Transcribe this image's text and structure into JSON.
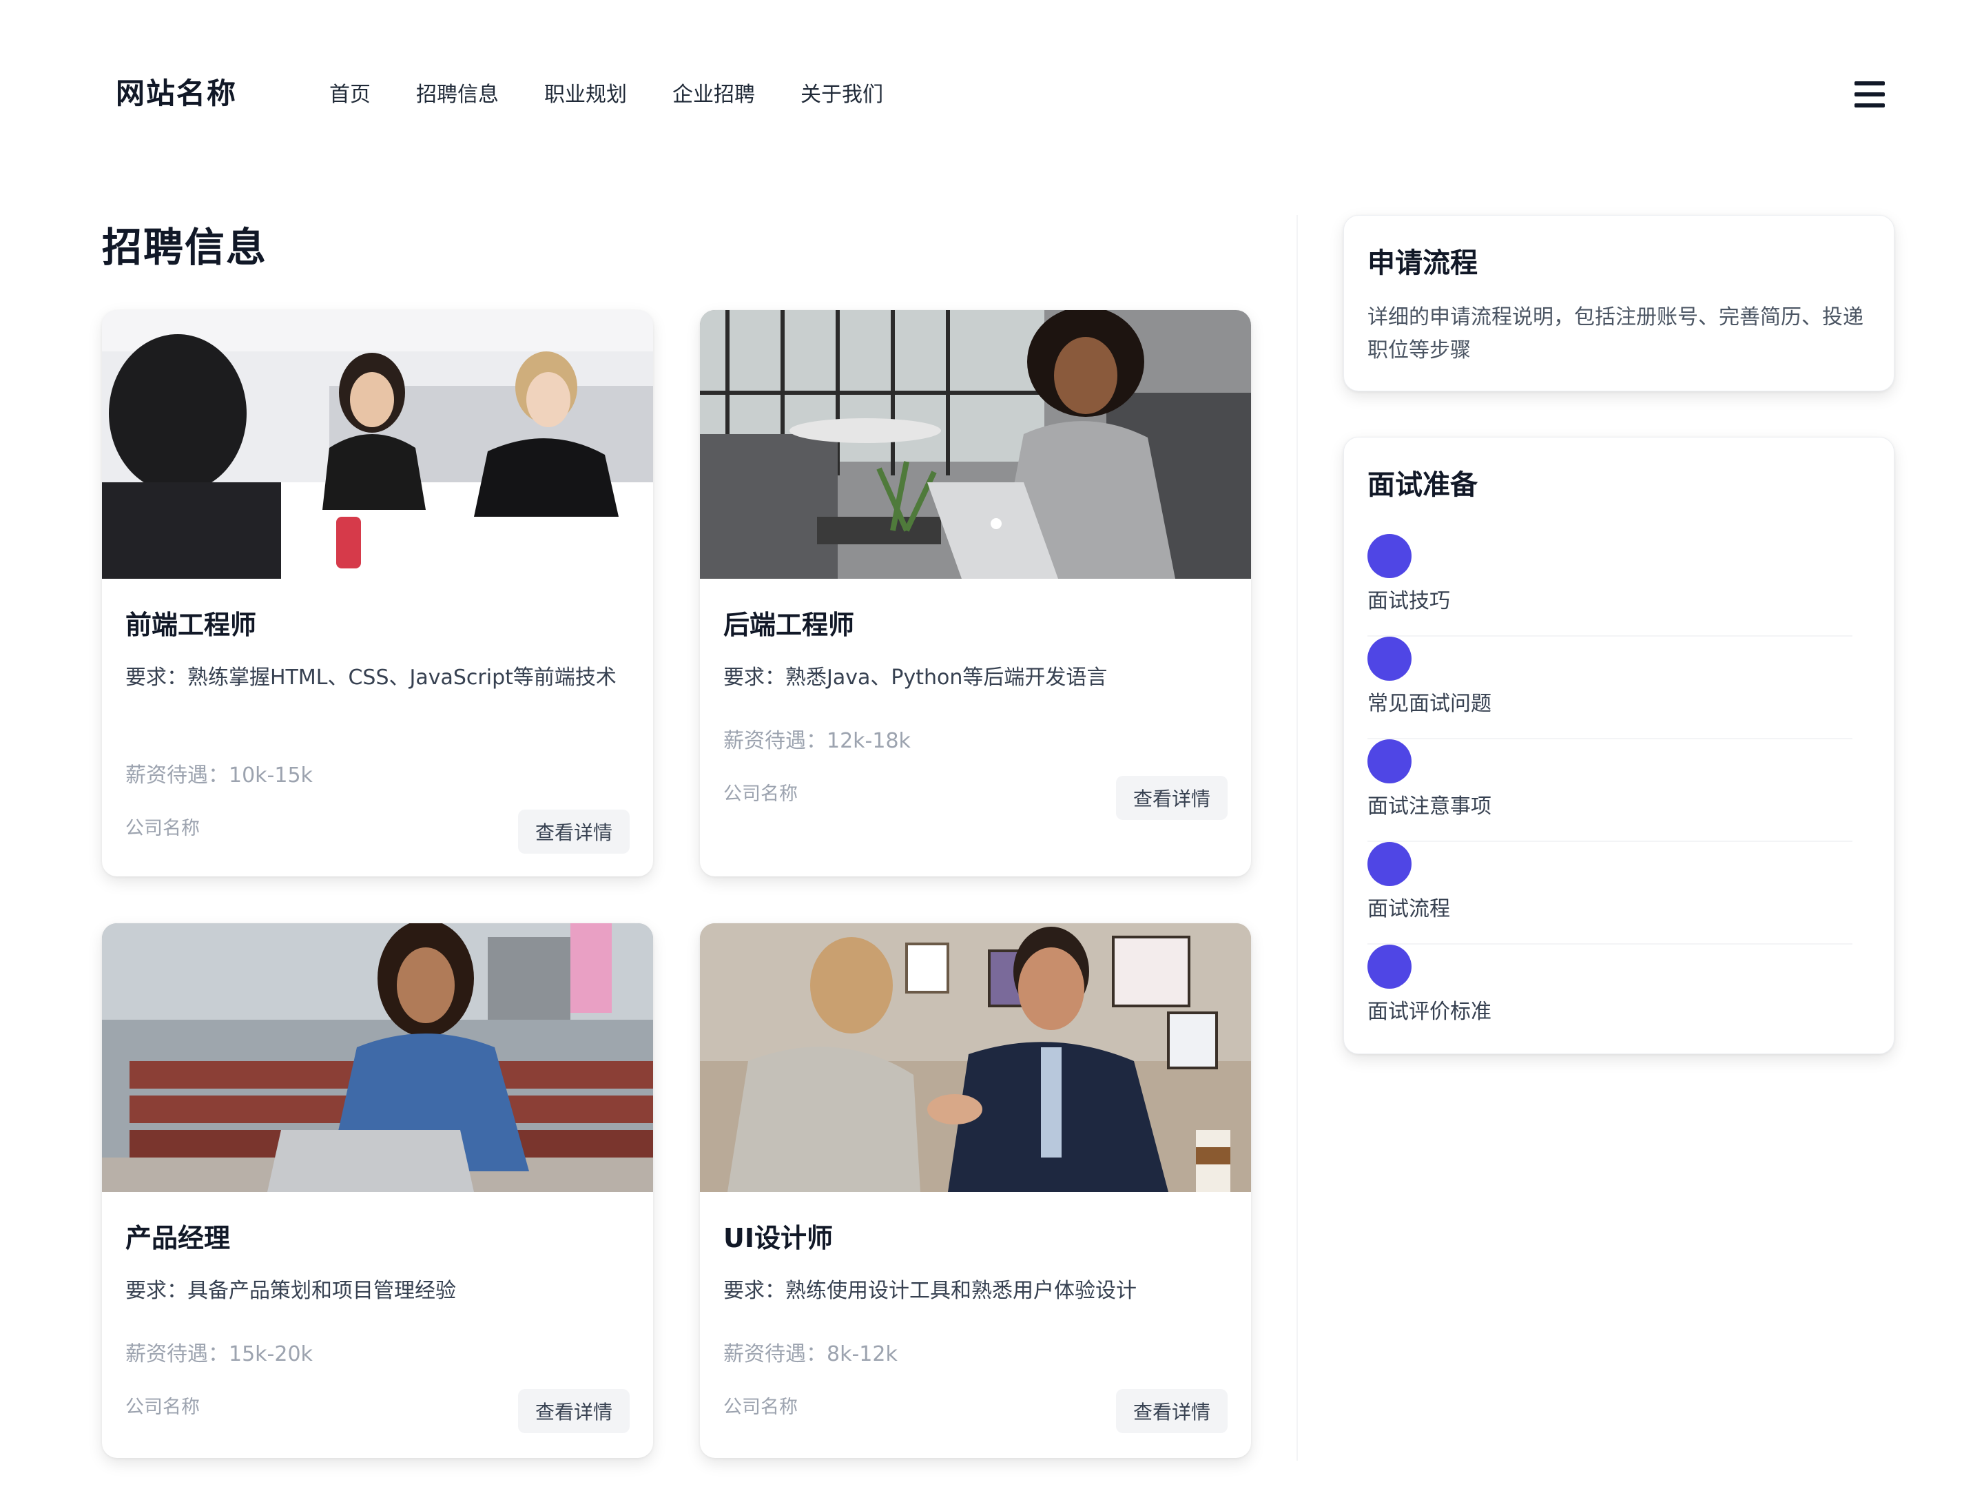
{
  "header": {
    "logo": "网站名称",
    "nav": [
      "首页",
      "招聘信息",
      "职业规划",
      "企业招聘",
      "关于我们"
    ],
    "menu_icon": "hamburger-menu-icon"
  },
  "main": {
    "title": "招聘信息",
    "jobs": [
      {
        "title": "前端工程师",
        "requirement": "要求：熟练掌握HTML、CSS、JavaScript等前端技术",
        "salary": "薪资待遇：10k-15k",
        "company": "公司名称",
        "button": "查看详情",
        "image": "photo-office-meeting"
      },
      {
        "title": "后端工程师",
        "requirement": "要求：熟悉Java、Python等后端开发语言",
        "salary": "薪资待遇：12k-18k",
        "company": "公司名称",
        "button": "查看详情",
        "image": "photo-woman-laptop-lounge"
      },
      {
        "title": "产品经理",
        "requirement": "要求：具备产品策划和项目管理经验",
        "salary": "薪资待遇：15k-20k",
        "company": "公司名称",
        "button": "查看详情",
        "image": "photo-woman-phone-bench"
      },
      {
        "title": "UI设计师",
        "requirement": "要求：熟练使用设计工具和熟悉用户体验设计",
        "salary": "薪资待遇：8k-12k",
        "company": "公司名称",
        "button": "查看详情",
        "image": "photo-handshake"
      }
    ]
  },
  "sidebar": {
    "process": {
      "title": "申请流程",
      "text": "详细的申请流程说明，包括注册账号、完善简历、投递职位等步骤"
    },
    "prep": {
      "title": "面试准备",
      "items": [
        "面试技巧",
        "常见面试问题",
        "面试注意事项",
        "面试流程",
        "面试评价标准"
      ]
    }
  },
  "colors": {
    "accent": "#4f46e5",
    "text": "#111827",
    "muted": "#9ca3af",
    "button_bg": "#f3f4f6"
  }
}
